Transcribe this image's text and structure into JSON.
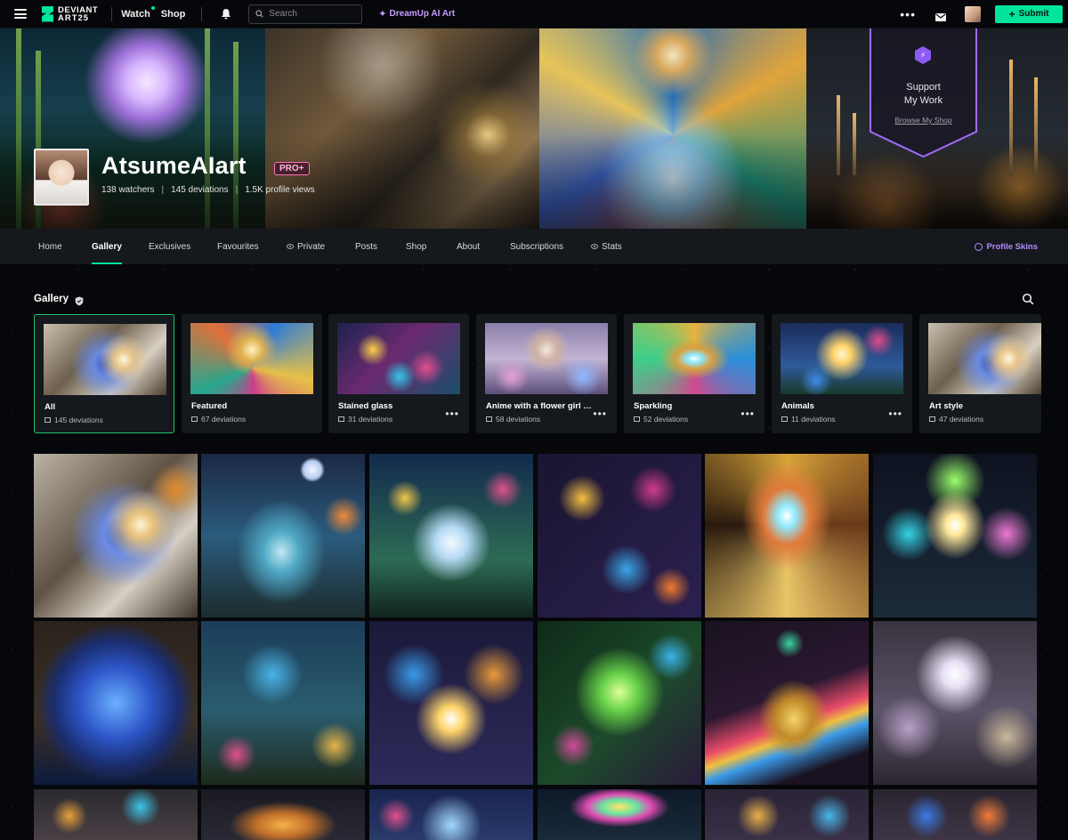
{
  "topbar": {
    "logo_line1": "DEVIANT",
    "logo_line2": "ART25",
    "watch_label": "Watch",
    "shop_label": "Shop",
    "search_placeholder": "Search",
    "dreamup_label": "DreamUp AI Art",
    "more_label": "•••",
    "submit_label": "Submit"
  },
  "profile": {
    "name": "AtsumeAIart",
    "badge": "PRO+",
    "watchers": "138 watchers",
    "deviations": "145 deviations",
    "views": "1.5K profile views"
  },
  "shop_card": {
    "line1": "Support",
    "line2": "My Work",
    "link": "Browse My Shop"
  },
  "tabs": [
    {
      "label": "Home"
    },
    {
      "label": "Gallery"
    },
    {
      "label": "Exclusives"
    },
    {
      "label": "Favourites"
    },
    {
      "label": "Private"
    },
    {
      "label": "Posts"
    },
    {
      "label": "Shop"
    },
    {
      "label": "About"
    },
    {
      "label": "Subscriptions"
    },
    {
      "label": "Stats"
    }
  ],
  "profile_skins_label": "Profile Skins",
  "gallery": {
    "title": "Gallery",
    "folders": [
      {
        "name": "All",
        "count": "145 deviations"
      },
      {
        "name": "Featured",
        "count": "67 deviations"
      },
      {
        "name": "Stained glass",
        "count": "31 deviations"
      },
      {
        "name": "Anime with a flower girl m...",
        "count": "58 deviations"
      },
      {
        "name": "Sparkling",
        "count": "52 deviations"
      },
      {
        "name": "Animals",
        "count": "11 deviations"
      },
      {
        "name": "Art style",
        "count": "47 deviations"
      }
    ]
  },
  "colors": {
    "accent_green": "#00e59b",
    "dreamup_purple": "#c69cff",
    "pro_pink": "#ff6fbd",
    "tab_bar": "#15181c"
  },
  "icons": [
    "hamburger-icon",
    "bell-icon",
    "search-icon",
    "sparkle-icon",
    "mail-icon",
    "eye-icon",
    "palette-icon",
    "shield-icon",
    "image-icon",
    "more-icon",
    "plus-icon"
  ]
}
